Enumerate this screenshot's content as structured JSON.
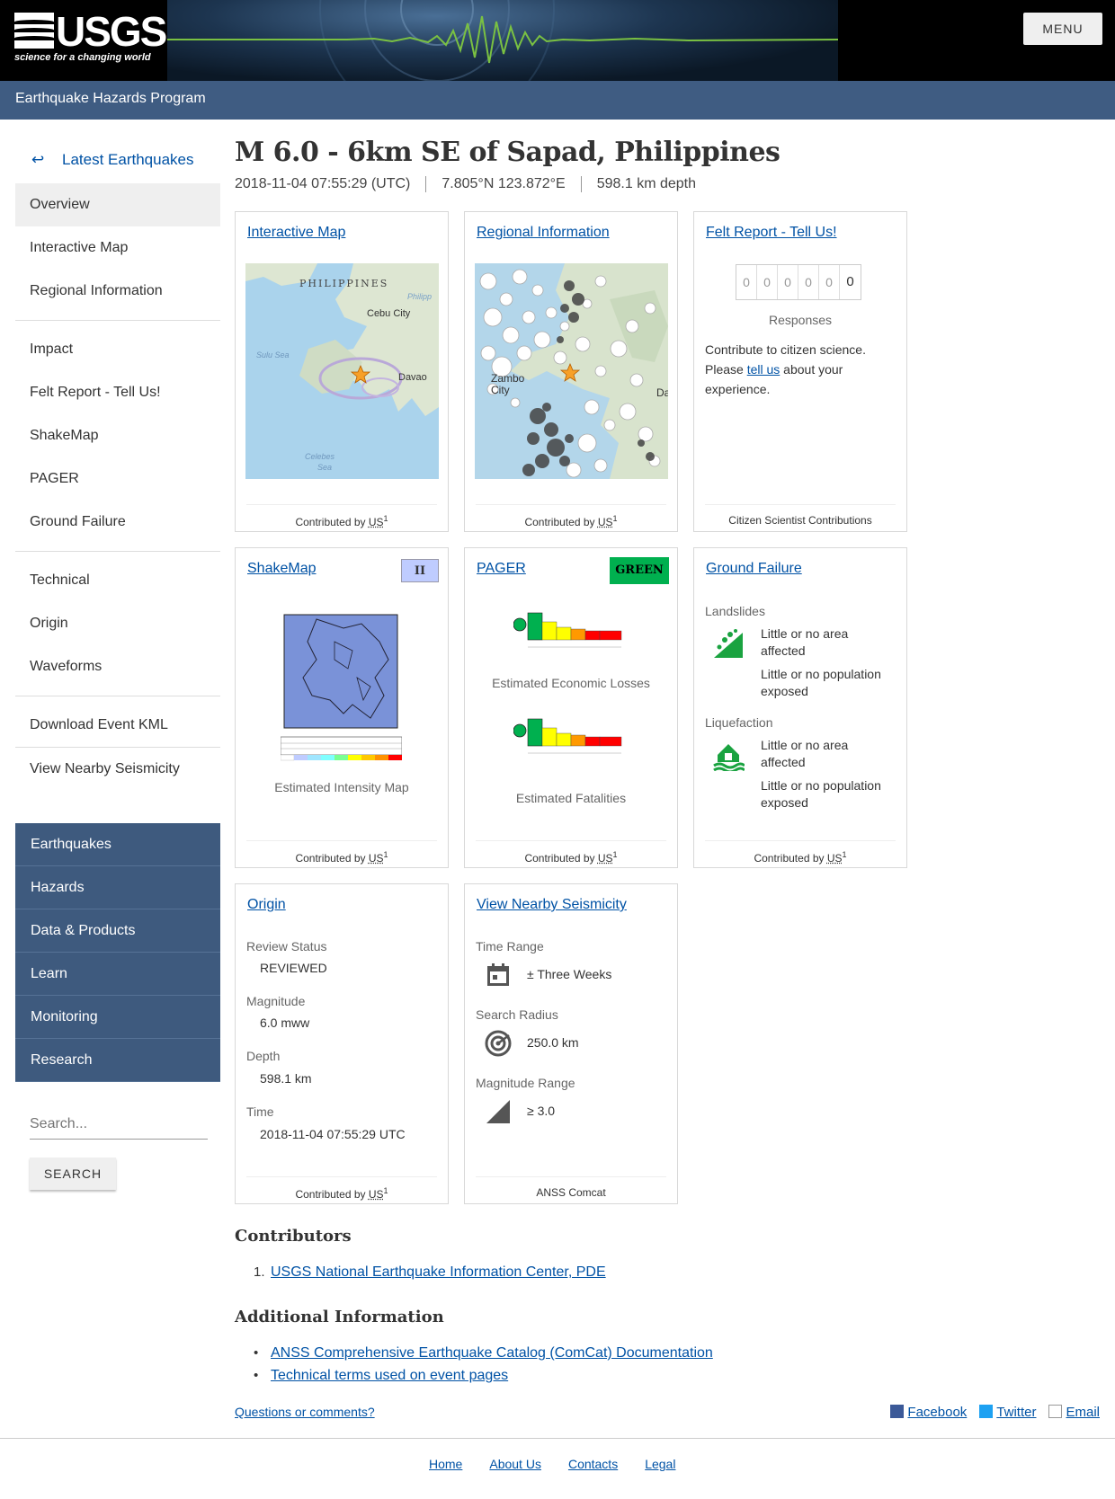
{
  "header": {
    "logo_text": "USGS",
    "logo_tagline": "science for a changing world",
    "menu_label": "MENU",
    "program": "Earthquake Hazards Program"
  },
  "event": {
    "title": "M 6.0 - 6km SE of Sapad, Philippines",
    "time": "2018-11-04 07:55:29 (UTC)",
    "location": "7.805°N 123.872°E",
    "depth": "598.1 km depth"
  },
  "sidebar": {
    "back_arrow": "↩",
    "back_label": "Latest Earthquakes",
    "group1": [
      "Overview",
      "Interactive Map",
      "Regional Information"
    ],
    "group2": [
      "Impact",
      "Felt Report - Tell Us!",
      "ShakeMap",
      "PAGER",
      "Ground Failure"
    ],
    "group3": [
      "Technical",
      "Origin",
      "Waveforms"
    ],
    "group4": [
      "Download Event KML"
    ],
    "group5": [
      "View Nearby Seismicity"
    ],
    "nav": [
      "Earthquakes",
      "Hazards",
      "Data & Products",
      "Learn",
      "Monitoring",
      "Research"
    ],
    "search_placeholder": "Search...",
    "search_button": "SEARCH"
  },
  "cards": {
    "interactive_map": {
      "title": "Interactive Map",
      "map_labels": [
        "PHILIPPINES",
        "Philipp",
        "Cebu City",
        "Sulu Sea",
        "Davao",
        "Celebes",
        "Sea"
      ],
      "contributed_prefix": "Contributed by ",
      "contributor": "US",
      "sup": "1"
    },
    "regional": {
      "title": "Regional Information",
      "map_labels": [
        "Zambo",
        "City",
        "Da"
      ],
      "contributed_prefix": "Contributed by ",
      "contributor": "US",
      "sup": "1"
    },
    "felt": {
      "title": "Felt Report - Tell Us!",
      "digits": [
        "0",
        "0",
        "0",
        "0",
        "0",
        "0"
      ],
      "responses": "Responses",
      "text_before": "Contribute to citizen science. Please ",
      "link": "tell us",
      "text_after": " about your experience.",
      "footer": "Citizen Scientist Contributions"
    },
    "shakemap": {
      "title": "ShakeMap",
      "badge": "II",
      "badge_color": "#bfccff",
      "caption": "Estimated Intensity Map",
      "contributed_prefix": "Contributed by ",
      "contributor": "US",
      "sup": "1"
    },
    "pager": {
      "title": "PAGER",
      "badge": "GREEN",
      "badge_color": "#00b04f",
      "caption_losses": "Estimated Economic Losses",
      "caption_fatalities": "Estimated Fatalities",
      "contributed_prefix": "Contributed by ",
      "contributor": "US",
      "sup": "1"
    },
    "ground_failure": {
      "title": "Ground Failure",
      "landslides": "Landslides",
      "liquefaction": "Liquefaction",
      "area": "Little or no area affected",
      "population": "Little or no population exposed",
      "contributed_prefix": "Contributed by ",
      "contributor": "US",
      "sup": "1"
    },
    "origin": {
      "title": "Origin",
      "review_label": "Review Status",
      "review_value": "REVIEWED",
      "magnitude_label": "Magnitude",
      "magnitude_value": "6.0 mww",
      "depth_label": "Depth",
      "depth_value": "598.1 km",
      "time_label": "Time",
      "time_value": "2018-11-04 07:55:29 UTC",
      "contributed_prefix": "Contributed by ",
      "contributor": "US",
      "sup": "1"
    },
    "nearby": {
      "title": "View Nearby Seismicity",
      "time_label": "Time Range",
      "time_value": "± Three Weeks",
      "radius_label": "Search Radius",
      "radius_value": "250.0 km",
      "mag_label": "Magnitude Range",
      "mag_value": "≥ 3.0",
      "footer": "ANSS Comcat"
    }
  },
  "contributors": {
    "heading": "Contributors",
    "items": [
      {
        "marker": "1.",
        "text": "USGS National Earthquake Information Center, PDE"
      }
    ]
  },
  "additional": {
    "heading": "Additional Information",
    "items": [
      {
        "marker": "•",
        "text": "ANSS Comprehensive Earthquake Catalog (ComCat) Documentation"
      },
      {
        "marker": "•",
        "text": "Technical terms used on event pages"
      }
    ]
  },
  "footer": {
    "questions": "Questions or comments?",
    "social": [
      "Facebook",
      "Twitter",
      "Email"
    ],
    "links": [
      "Home",
      "About Us",
      "Contacts",
      "Legal"
    ]
  }
}
